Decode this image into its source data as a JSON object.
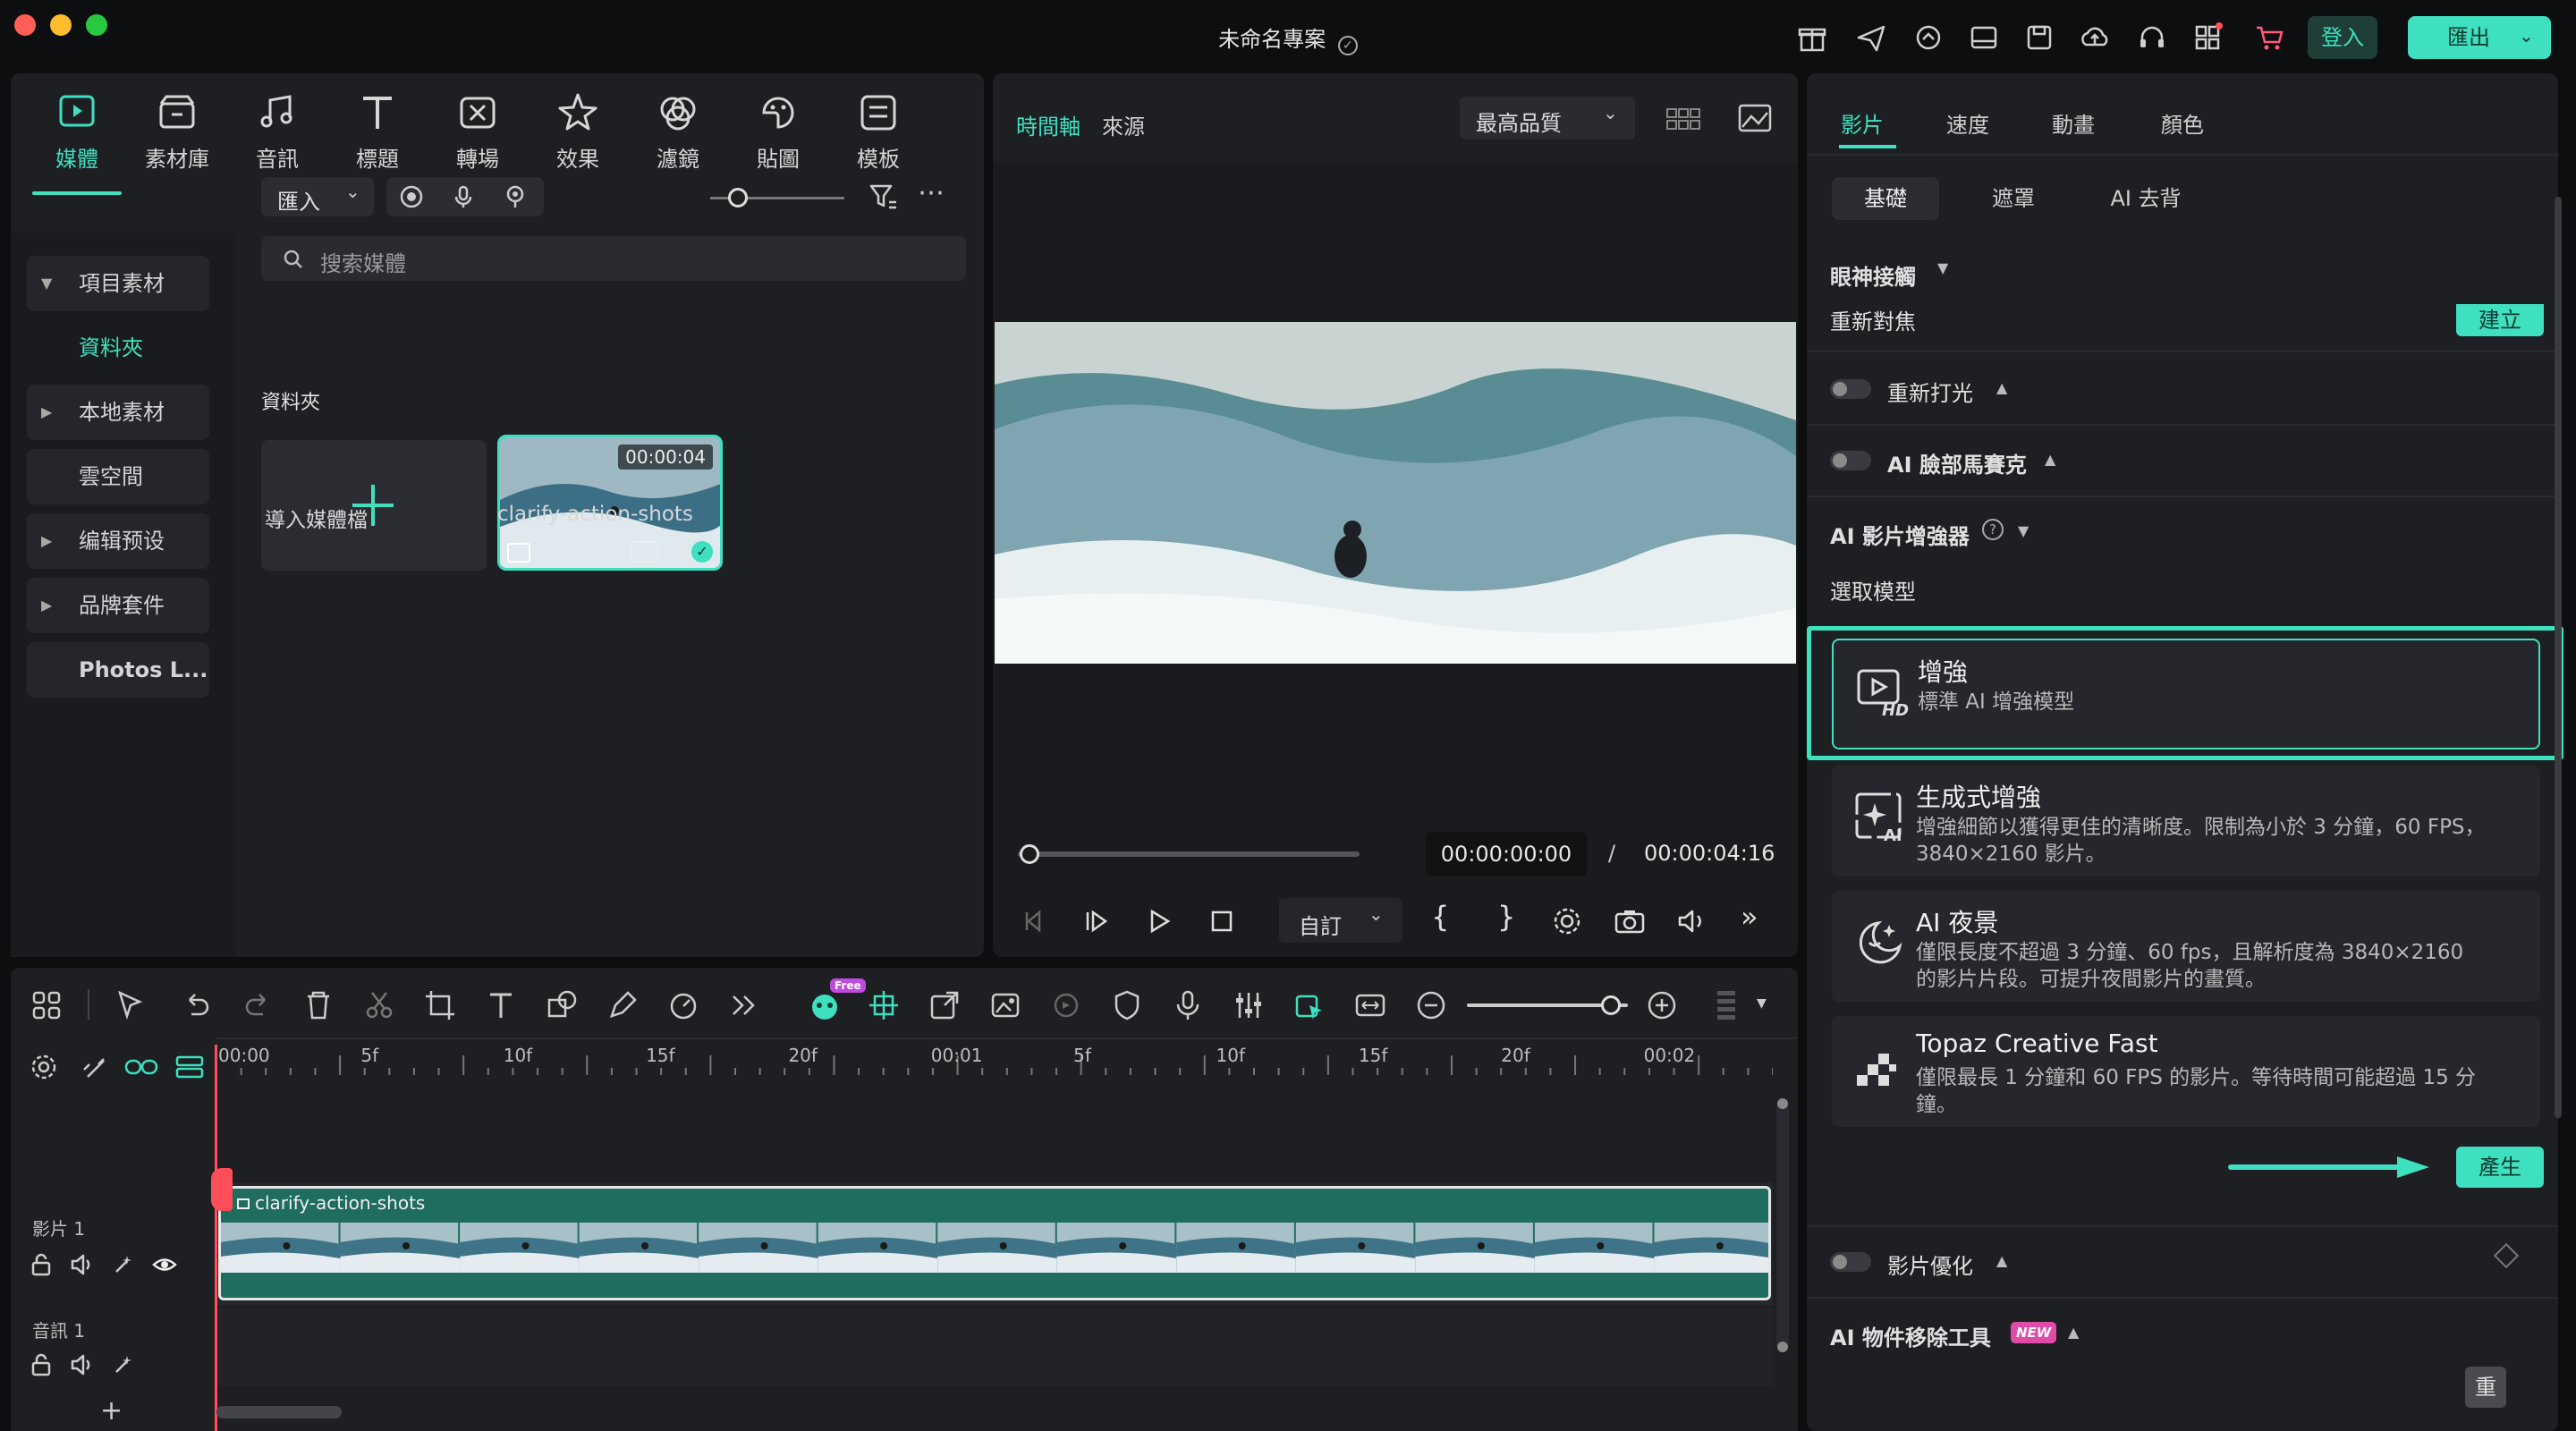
{
  "window": {
    "title": "未命名專案"
  },
  "header": {
    "login_label": "登入",
    "export_label": "匯出"
  },
  "media_tabs": [
    {
      "label": "媒體",
      "icon": "media-icon"
    },
    {
      "label": "素材庫",
      "icon": "stock-icon"
    },
    {
      "label": "音訊",
      "icon": "music-icon"
    },
    {
      "label": "標題",
      "icon": "title-icon"
    },
    {
      "label": "轉場",
      "icon": "transition-icon"
    },
    {
      "label": "效果",
      "icon": "effects-icon"
    },
    {
      "label": "濾鏡",
      "icon": "filter-icon"
    },
    {
      "label": "貼圖",
      "icon": "sticker-icon"
    },
    {
      "label": "模板",
      "icon": "template-icon"
    }
  ],
  "sidebar": {
    "items": [
      {
        "label": "項目素材"
      },
      {
        "label": "資料夾"
      },
      {
        "label": "本地素材"
      },
      {
        "label": "雲空間"
      },
      {
        "label": "编辑预设"
      },
      {
        "label": "品牌套件"
      },
      {
        "label": "Photos L..."
      }
    ]
  },
  "media": {
    "import_label": "匯入",
    "search_placeholder": "搜索媒體",
    "folder_label": "資料夾",
    "import_tile_label": "導入媒體檔",
    "clip_name": "clarify-action-shots",
    "clip_duration": "00:00:04"
  },
  "preview": {
    "tab_timeline": "時間軸",
    "tab_source": "來源",
    "quality": "最高品質",
    "current_time": "00:00:00:00",
    "separator": "/",
    "total_time": "00:00:04:16",
    "zoom_label": "自訂"
  },
  "props": {
    "tabs": [
      "影片",
      "速度",
      "動畫",
      "顏色"
    ],
    "sub_tabs": [
      "基礎",
      "遮罩",
      "AI 去背"
    ],
    "eye_contact": "眼神接觸",
    "refocus": "重新對焦",
    "create_label": "建立",
    "relight": "重新打光",
    "face_mosaic": "AI 臉部馬賽克",
    "enhancer": "AI 影片增強器",
    "select_model": "選取模型",
    "models": [
      {
        "title": "增強",
        "desc": "標準 AI 增強模型",
        "icon_text": "HD"
      },
      {
        "title": "生成式增強",
        "desc": "增強細節以獲得更佳的清晰度。限制為小於 3 分鐘，60 FPS，3840×2160 影片。",
        "icon_text": "AI"
      },
      {
        "title": "AI 夜景",
        "desc": "僅限長度不超過 3 分鐘、60 fps，且解析度為 3840×2160 的影片片段。可提升夜間影片的畫質。"
      },
      {
        "title": "Topaz Creative Fast",
        "desc": "僅限最長 1 分鐘和 60 FPS 的影片。等待時間可能超過 15 分鐘。"
      }
    ],
    "generate_label": "產生",
    "video_optimize": "影片優化",
    "object_remove": "AI 物件移除工具",
    "new_badge": "NEW",
    "reset_label": "重"
  },
  "timeline": {
    "free_badge": "Free",
    "ruler": [
      "00:00",
      "5f",
      "10f",
      "15f",
      "20f",
      "00:01",
      "5f",
      "10f",
      "15f",
      "20f",
      "00:02"
    ],
    "video_track": "影片 1",
    "audio_track": "音訊 1",
    "clip_label": "clarify-action-shots"
  },
  "colors": {
    "accent": "#3ee0bf",
    "playhead": "#ff4d5a"
  }
}
